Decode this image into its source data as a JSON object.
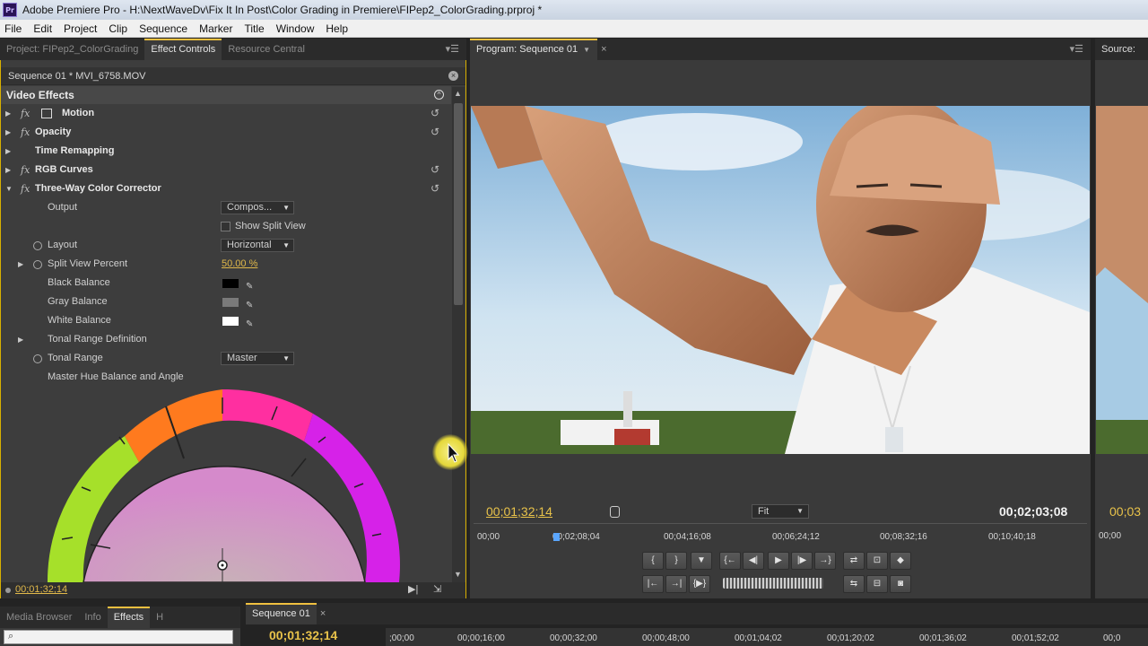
{
  "window": {
    "title": "Adobe Premiere Pro - H:\\NextWaveDv\\Fix It In Post\\Color Grading in Premiere\\FIPep2_ColorGrading.prproj *",
    "app_icon": "Pr"
  },
  "menu": [
    "File",
    "Edit",
    "Project",
    "Clip",
    "Sequence",
    "Marker",
    "Title",
    "Window",
    "Help"
  ],
  "left_tabs": [
    "Project: FIPep2_ColorGrading",
    "Effect Controls",
    "Resource Central"
  ],
  "effect_controls": {
    "clip_name": "Sequence 01 * MVI_6758.MOV",
    "section": "Video Effects",
    "effects": [
      {
        "label": "Motion"
      },
      {
        "label": "Opacity"
      },
      {
        "label": "Time Remapping"
      },
      {
        "label": "RGB Curves"
      },
      {
        "label": "Three-Way Color Corrector"
      }
    ],
    "params": {
      "output_label": "Output",
      "output_value": "Compos...",
      "split_view_label": "Show Split View",
      "layout_label": "Layout",
      "layout_value": "Horizontal",
      "split_pct_label": "Split View Percent",
      "split_pct_value": "50.00 %",
      "black_label": "Black Balance",
      "gray_label": "Gray Balance",
      "white_label": "White Balance",
      "tonal_def_label": "Tonal Range Definition",
      "tonal_label": "Tonal Range",
      "tonal_value": "Master",
      "hue_label": "Master Hue Balance and Angle"
    },
    "swatches": {
      "black": "#000000",
      "gray": "#7a7a7a",
      "white": "#ffffff"
    },
    "timecode": "00;01;32;14"
  },
  "program": {
    "tab": "Program: Sequence 01",
    "current_time": "00;01;32;14",
    "duration": "00;02;03;08",
    "zoom": "Fit",
    "ruler": [
      "00;00",
      "00;02;08;04",
      "00;04;16;08",
      "00;06;24;12",
      "00;08;32;16",
      "00;10;40;18"
    ]
  },
  "source": {
    "tab": "Source:",
    "time": "00;03",
    "ruler": "00;00"
  },
  "bottom": {
    "tabs": [
      "Media Browser",
      "Info",
      "Effects",
      "H"
    ],
    "sequence_tab": "Sequence 01",
    "sequence_time": "00;01;32;14",
    "ruler": [
      ";00;00",
      "00;00;16;00",
      "00;00;32;00",
      "00;00;48;00",
      "00;01;04;02",
      "00;01;20;02",
      "00;01;36;02",
      "00;01;52;02",
      "00;0"
    ]
  },
  "accent": "#f0c040"
}
